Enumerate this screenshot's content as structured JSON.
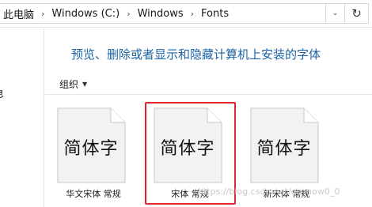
{
  "address_bar": {
    "breadcrumbs": [
      "此电脑",
      "Windows (C:)",
      "Windows",
      "Fonts"
    ],
    "separator": "›",
    "dropdown_glyph": "⌄",
    "refresh_glyph": "↻"
  },
  "nav": {
    "partial_text": "息"
  },
  "main": {
    "heading": "预览、删除或者显示和隐藏计算机上安装的字体",
    "toolbar": {
      "organize_label": "组织",
      "organize_caret": "▼"
    },
    "fonts": [
      {
        "sample": "简体字",
        "name": "华文宋体 常规",
        "selected": false
      },
      {
        "sample": "简体字",
        "name": "宋体 常规",
        "selected": true
      },
      {
        "sample": "简体字",
        "name": "新宋体 常规",
        "selected": false
      }
    ]
  },
  "watermark": "https://blog.csdn.net/qq_now0_0",
  "colors": {
    "heading": "#1d63a6",
    "selection_border": "#e0262b"
  }
}
